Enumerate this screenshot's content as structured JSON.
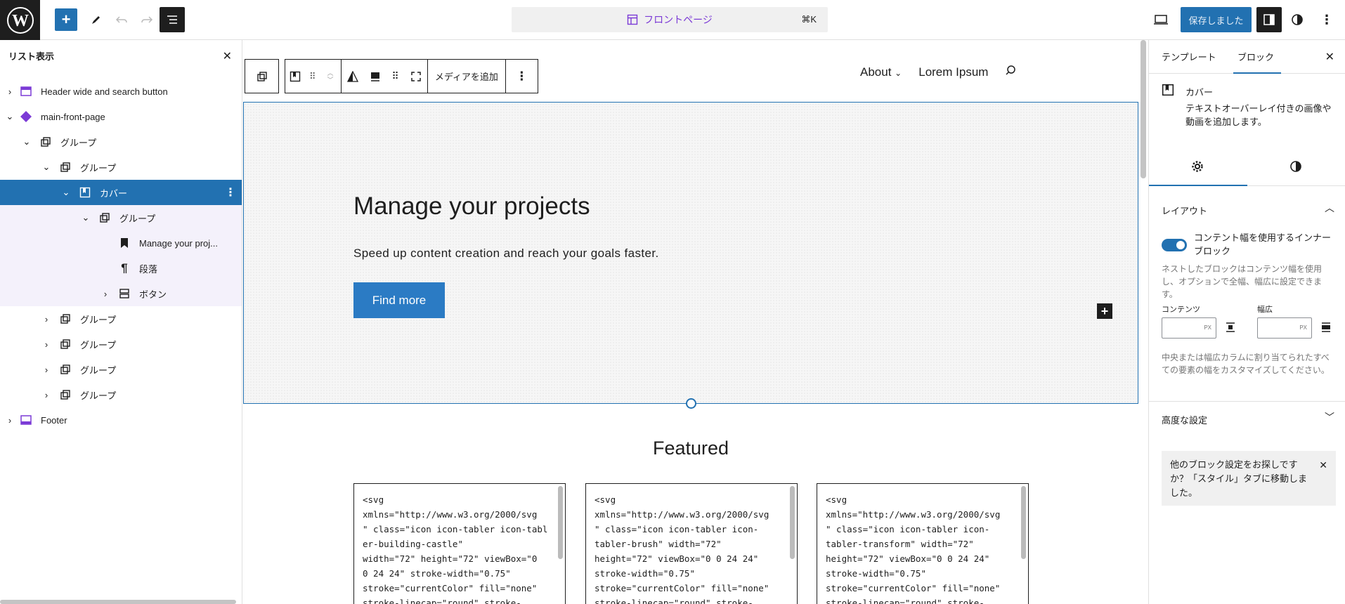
{
  "topbar": {
    "document_title": "フロントページ",
    "shortcut": "⌘K",
    "save_label": "保存しました"
  },
  "listview": {
    "title": "リスト表示",
    "items": [
      {
        "label": "Header wide and search button"
      },
      {
        "label": "main-front-page"
      },
      {
        "label": "グループ"
      },
      {
        "label": "グループ"
      },
      {
        "label": "カバー"
      },
      {
        "label": "グループ"
      },
      {
        "label": "Manage your proj..."
      },
      {
        "label": "段落"
      },
      {
        "label": "ボタン"
      },
      {
        "label": "グループ"
      },
      {
        "label": "グループ"
      },
      {
        "label": "グループ"
      },
      {
        "label": "グループ"
      },
      {
        "label": "Footer"
      }
    ]
  },
  "canvas": {
    "toolbar": {
      "add_media": "メディアを追加"
    },
    "nav": {
      "about": "About",
      "lorem": "Lorem Ipsum"
    },
    "cover": {
      "heading": "Manage your projects",
      "text": "Speed up content creation and reach your goals faster.",
      "button": "Find more"
    },
    "featured_title": "Featured",
    "cards": [
      {
        "code": "<svg\nxmlns=\"http://www.w3.org/2000/svg\n\" class=\"icon icon-tabler icon-tabler-building-castle\"\nwidth=\"72\" height=\"72\" viewBox=\"0\n0 24 24\" stroke-width=\"0.75\"\nstroke=\"currentColor\" fill=\"none\"\nstroke-linecap=\"round\" stroke-"
      },
      {
        "code": "<svg\nxmlns=\"http://www.w3.org/2000/svg\n\" class=\"icon icon-tabler icon-\ntabler-brush\" width=\"72\"\nheight=\"72\" viewBox=\"0 0 24 24\"\nstroke-width=\"0.75\"\nstroke=\"currentColor\" fill=\"none\"\nstroke-linecap=\"round\" stroke-"
      },
      {
        "code": "<svg\nxmlns=\"http://www.w3.org/2000/svg\n\" class=\"icon icon-tabler icon-\ntabler-transform\" width=\"72\"\nheight=\"72\" viewBox=\"0 0 24 24\"\nstroke-width=\"0.75\"\nstroke=\"currentColor\" fill=\"none\"\nstroke-linecap=\"round\" stroke-"
      }
    ]
  },
  "sidebar": {
    "tab_template": "テンプレート",
    "tab_block": "ブロック",
    "block_name": "カバー",
    "block_desc": "テキストオーバーレイ付きの画像や動画を追加します。",
    "layout": {
      "title": "レイアウト",
      "toggle_label": "コンテント幅を使用するインナーブロック",
      "toggle_help": "ネストしたブロックはコンテンツ幅を使用し、オプションで全幅、幅広に設定できます。",
      "content_label": "コンテンツ",
      "wide_label": "幅広",
      "unit": "PX",
      "size_help": "中央または幅広カラムに割り当てられたすべての要素の幅をカスタマイズしてください。"
    },
    "advanced_title": "高度な設定",
    "notice": "他のブロック設定をお探しですか？「スタイル」タブに移動しました。"
  },
  "colors": {
    "accent": "#2271b1",
    "dark": "#1e1e1e",
    "site_purple": "#7c3bd6"
  }
}
